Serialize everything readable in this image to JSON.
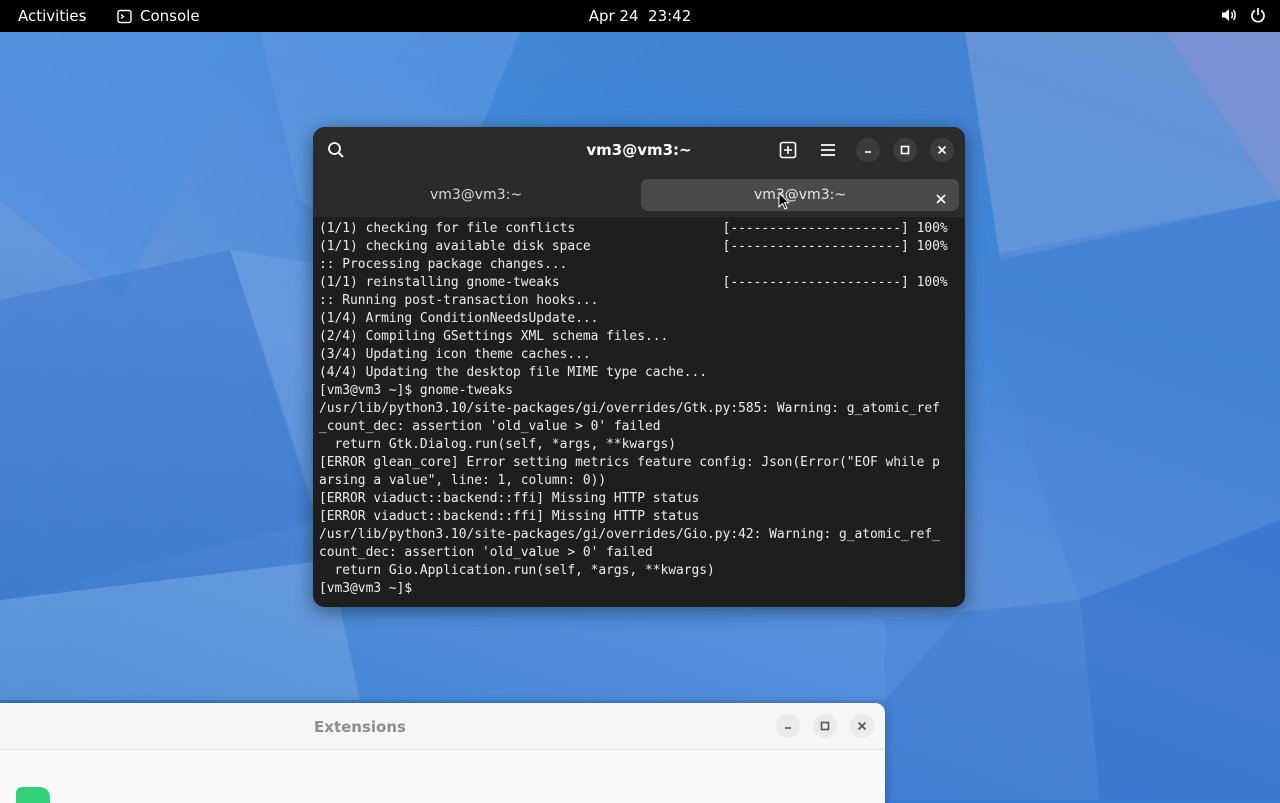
{
  "topbar": {
    "activities": "Activities",
    "app_name": "Console",
    "clock": "Apr 24  23:42",
    "icons": [
      "console-icon",
      "volume-icon",
      "power-icon"
    ]
  },
  "terminal": {
    "title": "vm3@vm3:~",
    "tabs": [
      {
        "label": "vm3@vm3:~",
        "active": false
      },
      {
        "label": "vm3@vm3:~",
        "active": true
      }
    ],
    "output": "(1/1) checking for file conflicts                   [----------------------] 100%\n(1/1) checking available disk space                 [----------------------] 100%\n:: Processing package changes...\n(1/1) reinstalling gnome-tweaks                     [----------------------] 100%\n:: Running post-transaction hooks...\n(1/4) Arming ConditionNeedsUpdate...\n(2/4) Compiling GSettings XML schema files...\n(3/4) Updating icon theme caches...\n(4/4) Updating the desktop file MIME type cache...\n[vm3@vm3 ~]$ gnome-tweaks\n/usr/lib/python3.10/site-packages/gi/overrides/Gtk.py:585: Warning: g_atomic_ref\n_count_dec: assertion 'old_value > 0' failed\n  return Gtk.Dialog.run(self, *args, **kwargs)\n[ERROR glean_core] Error setting metrics feature config: Json(Error(\"EOF while p\narsing a value\", line: 1, column: 0))\n[ERROR viaduct::backend::ffi] Missing HTTP status\n[ERROR viaduct::backend::ffi] Missing HTTP status\n/usr/lib/python3.10/site-packages/gi/overrides/Gio.py:42: Warning: g_atomic_ref_\ncount_dec: assertion 'old_value > 0' failed\n  return Gio.Application.run(self, *args, **kwargs)\n[vm3@vm3 ~]$"
  },
  "extensions_window": {
    "title": "Extensions"
  },
  "colors": {
    "topbar_bg": "#000000",
    "terminal_bg": "#1e1e1e",
    "terminal_header": "#2b2b2b",
    "active_tab": "#4a4a4a",
    "extensions_accent": "#33d17a"
  }
}
